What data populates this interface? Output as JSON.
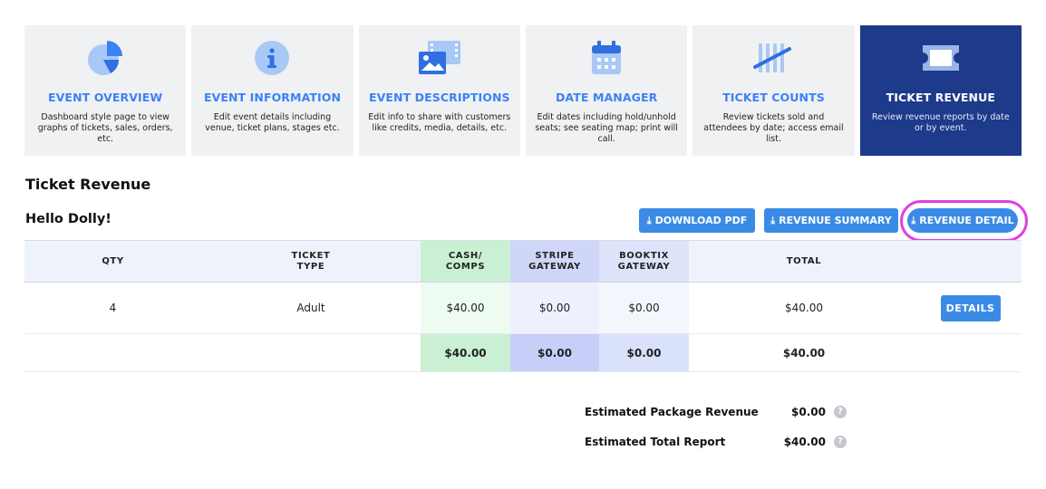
{
  "nav_cards": [
    {
      "title": "EVENT OVERVIEW",
      "description": "Dashboard style page to view graphs of tickets, sales, orders, etc.",
      "icon": "pie-chart-icon",
      "active": false
    },
    {
      "title": "EVENT INFORMATION",
      "description": "Edit event details including venue, ticket plans, stages etc.",
      "icon": "info-icon",
      "active": false
    },
    {
      "title": "EVENT DESCRIPTIONS",
      "description": "Edit info to share with customers like credits, media, details, etc.",
      "icon": "media-gallery-icon",
      "active": false
    },
    {
      "title": "DATE MANAGER",
      "description": "Edit dates including hold/unhold seats; see seating map; print will call.",
      "icon": "calendar-icon",
      "active": false
    },
    {
      "title": "TICKET COUNTS",
      "description": "Review tickets sold and attendees by date; access email list.",
      "icon": "tally-marks-icon",
      "active": false
    },
    {
      "title": "TICKET REVENUE",
      "description": "Review revenue reports by date or by event.",
      "icon": "ticket-icon",
      "active": true
    }
  ],
  "section_title": "Ticket Revenue",
  "event_name": "Hello Dolly!",
  "buttons": {
    "download_pdf": "DOWNLOAD PDF",
    "revenue_summary": "REVENUE SUMMARY",
    "revenue_detail": "REVENUE DETAIL",
    "download_icon": "download-icon"
  },
  "table": {
    "headers": {
      "qty": "QTY",
      "ticket_type_line1": "TICKET",
      "ticket_type_line2": "TYPE",
      "cash_line1": "CASH/",
      "cash_line2": "COMPS",
      "stripe_line1": "STRIPE",
      "stripe_line2": "GATEWAY",
      "booktix_line1": "BOOKTIX",
      "booktix_line2": "GATEWAY",
      "total": "TOTAL"
    },
    "rows": [
      {
        "qty": "4",
        "ticket_type": "Adult",
        "cash": "$40.00",
        "stripe": "$0.00",
        "booktix": "$0.00",
        "total": "$40.00",
        "action": "DETAILS"
      }
    ],
    "totals": {
      "cash": "$40.00",
      "stripe": "$0.00",
      "booktix": "$0.00",
      "total": "$40.00"
    }
  },
  "summary": {
    "package_label": "Estimated Package Revenue",
    "package_value": "$0.00",
    "total_label": "Estimated Total Report",
    "total_value": "$40.00",
    "help_glyph": "?"
  },
  "colors": {
    "accent": "#3b8be6",
    "active_card": "#1e3a8a",
    "highlight_ring": "#e040e0",
    "cash_column": "#c9f0d3",
    "stripe_column": "#cfd6f8"
  }
}
